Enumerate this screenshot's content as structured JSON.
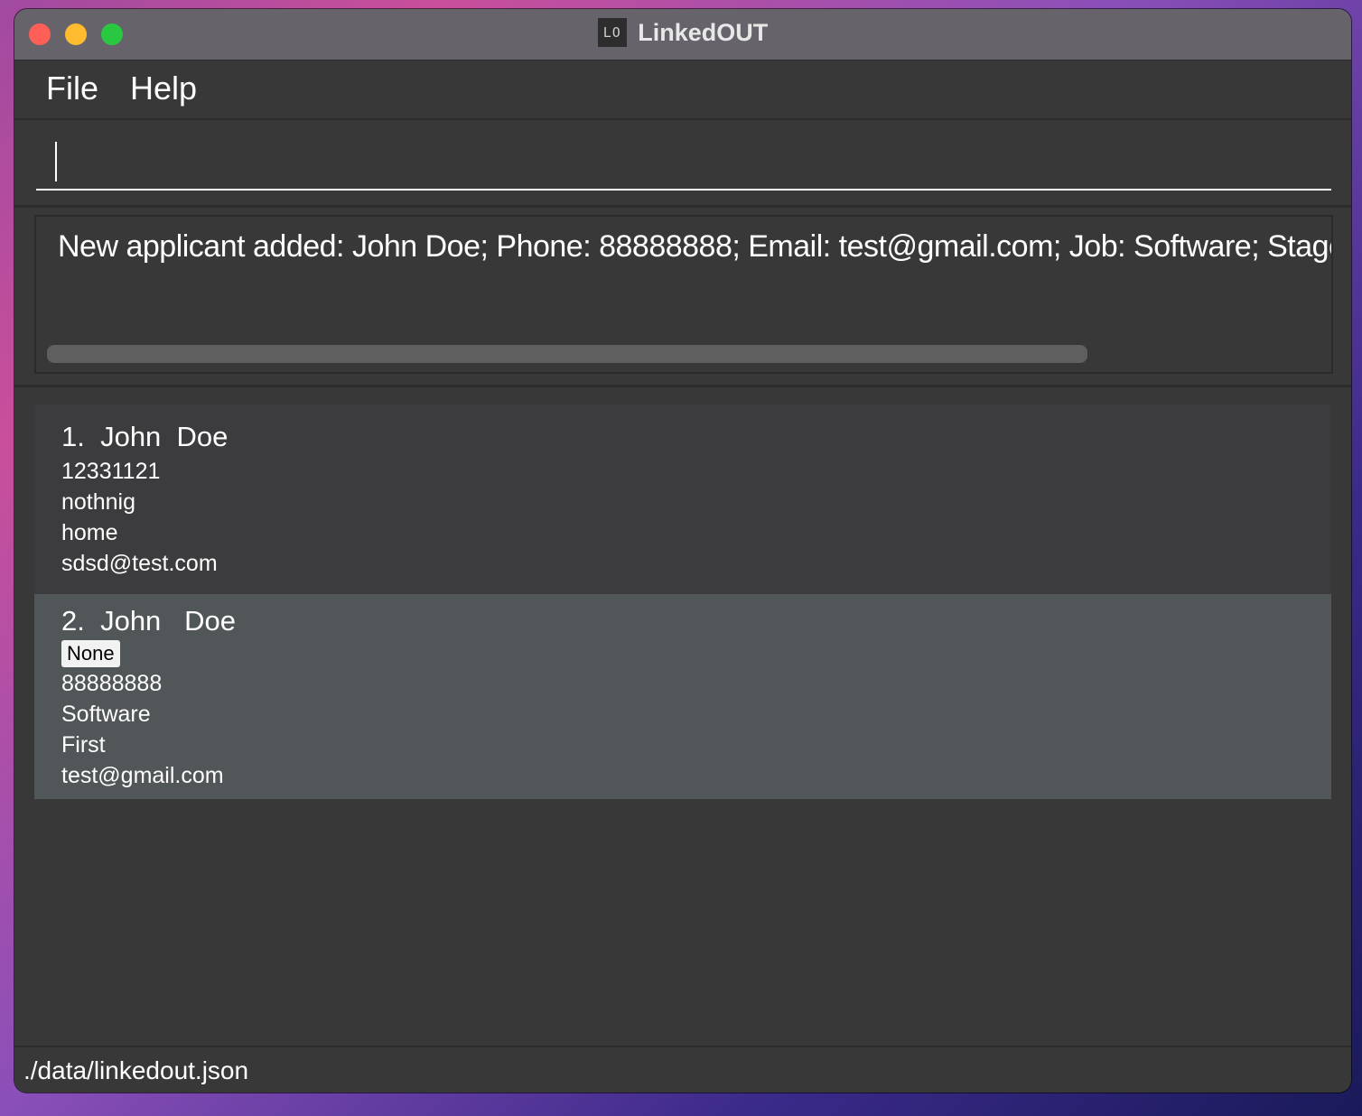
{
  "window": {
    "title": "LinkedOUT",
    "icon_text": "LO"
  },
  "menu": {
    "file": "File",
    "help": "Help"
  },
  "command": {
    "value": "",
    "placeholder": ""
  },
  "result": {
    "text": "New applicant added: John   Doe; Phone: 88888888; Email: test@gmail.com; Job: Software; Stage"
  },
  "applicants": [
    {
      "name": "1.  John  Doe",
      "lines": [
        "12331121",
        "nothnig",
        "home",
        "sdsd@test.com"
      ]
    },
    {
      "name": "2.  John   Doe",
      "tag": "None",
      "lines": [
        "88888888",
        "Software",
        "First",
        "test@gmail.com"
      ]
    }
  ],
  "status": {
    "path": "./data/linkedout.json"
  },
  "colors": {
    "background": "#383838",
    "selected_card": "#515659",
    "card": "#3c3c3e",
    "titlebar": "#67636a"
  }
}
